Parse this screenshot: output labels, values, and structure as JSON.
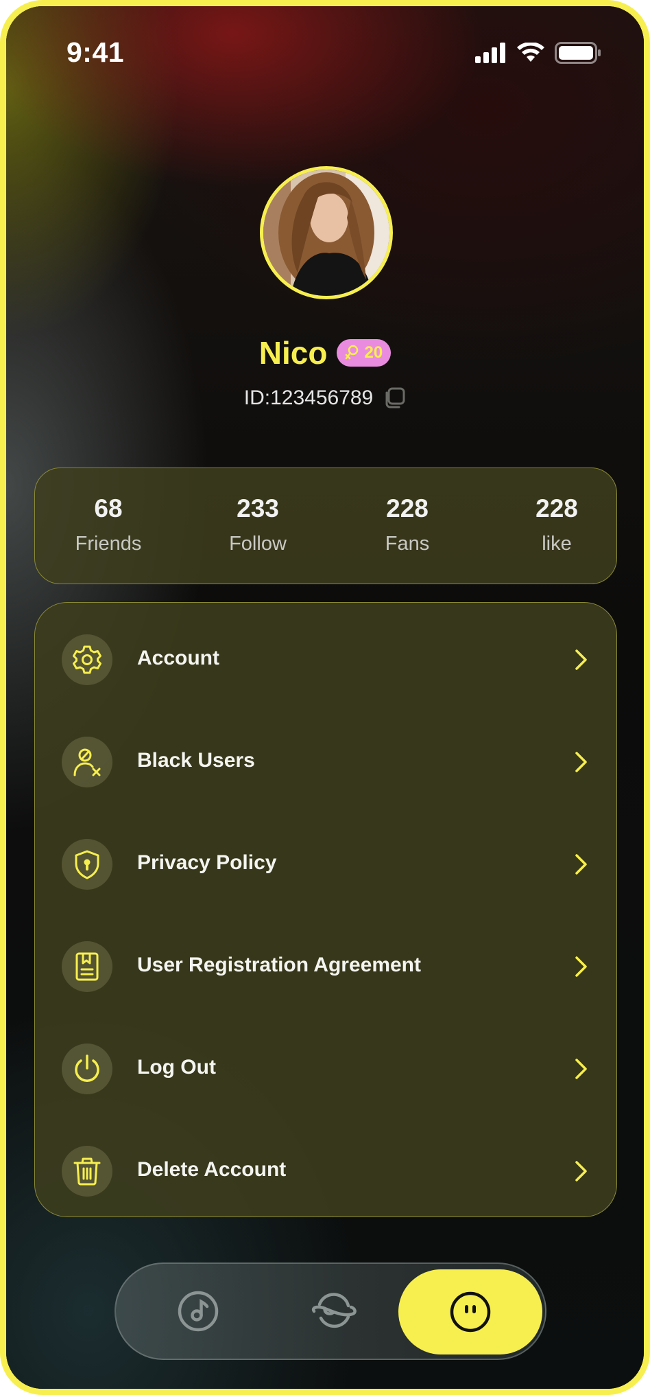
{
  "status_bar": {
    "time": "9:41"
  },
  "profile": {
    "name": "Nico",
    "badge_value": "20",
    "id_text": "ID:123456789"
  },
  "stats": [
    {
      "value": "68",
      "label": "Friends"
    },
    {
      "value": "233",
      "label": "Follow"
    },
    {
      "value": "228",
      "label": "Fans"
    },
    {
      "value": "228",
      "label": "like"
    }
  ],
  "menu": [
    {
      "label": "Account",
      "icon": "gear-icon"
    },
    {
      "label": "Black Users",
      "icon": "user-block-icon"
    },
    {
      "label": "Privacy Policy",
      "icon": "shield-icon"
    },
    {
      "label": "User Registration Agreement",
      "icon": "document-icon"
    },
    {
      "label": "Log Out",
      "icon": "power-icon"
    },
    {
      "label": "Delete Account",
      "icon": "trash-icon"
    }
  ],
  "tabbar": {
    "tabs": [
      {
        "icon": "music-disc-icon",
        "active": false
      },
      {
        "icon": "planet-icon",
        "active": false
      },
      {
        "icon": "face-icon",
        "active": true
      }
    ]
  },
  "colors": {
    "accent": "#f7ef4f",
    "badge_bg": "#e98ce0",
    "card_bg": "#3e3e1e"
  }
}
